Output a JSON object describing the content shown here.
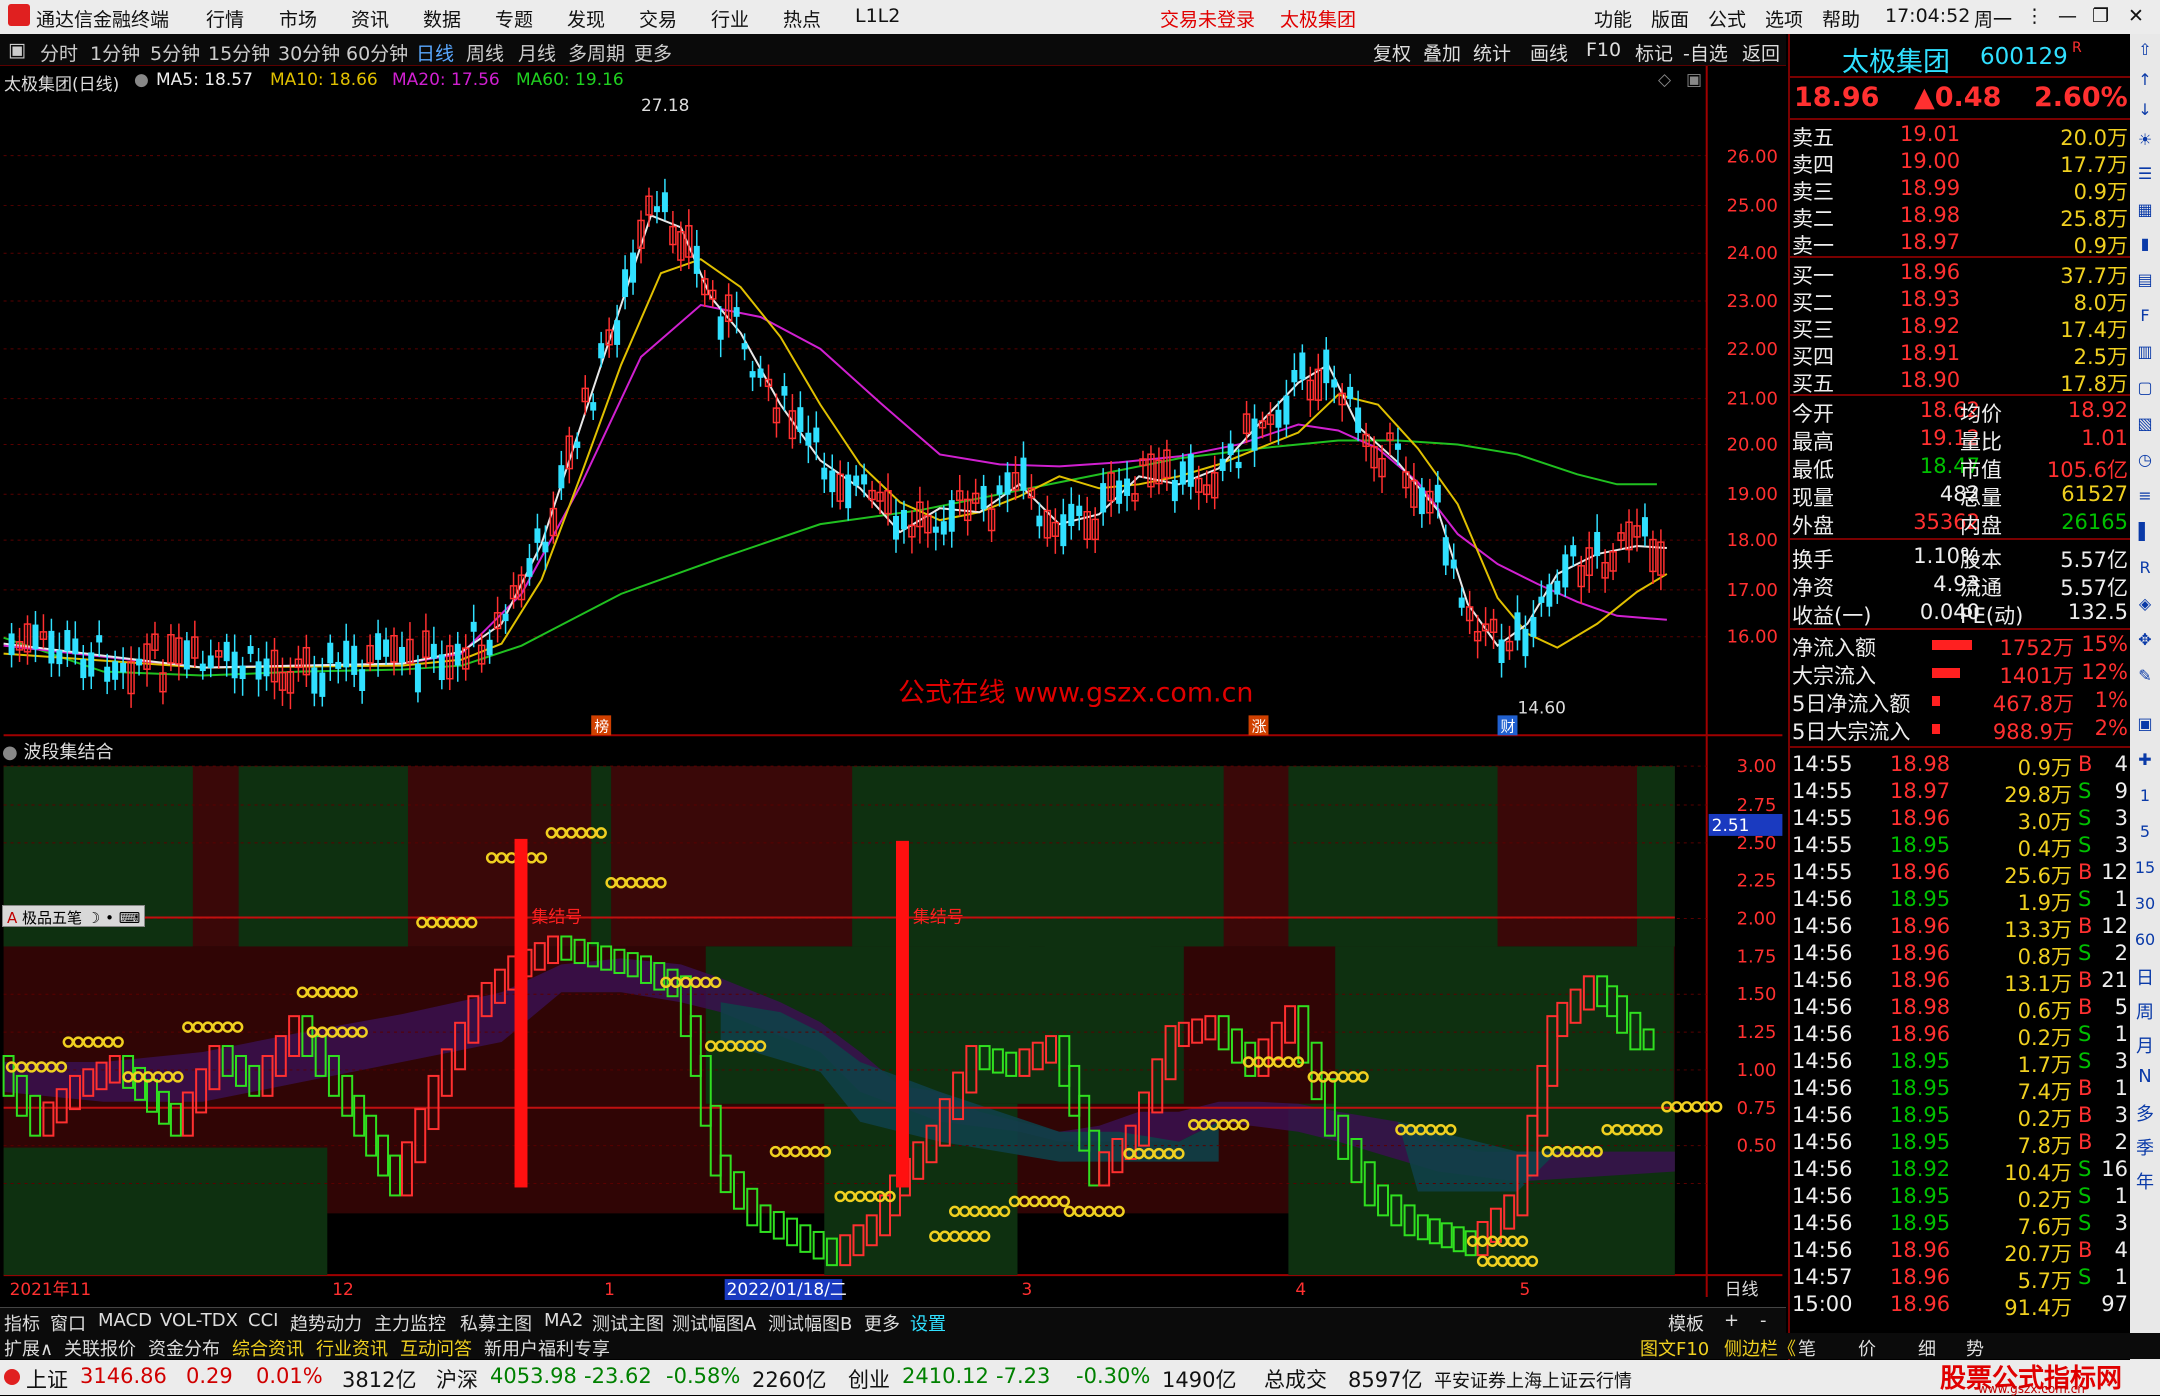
{
  "titlebar": {
    "app": "通达信金融终端",
    "menu": [
      "行情",
      "市场",
      "资讯",
      "数据",
      "专题",
      "发现",
      "交易",
      "行业",
      "热点",
      "L1L2"
    ],
    "login": "交易未登录",
    "stock": "太极集团",
    "right_menu": [
      "功能",
      "版面",
      "公式",
      "选项",
      "帮助"
    ],
    "time": "17:04:52",
    "weekday": "周一"
  },
  "periodbar": {
    "items": [
      "分时",
      "1分钟",
      "5分钟",
      "15分钟",
      "30分钟",
      "60分钟",
      "日线",
      "周线",
      "月线",
      "多周期",
      "更多"
    ],
    "active": "日线",
    "right": [
      "复权",
      "叠加",
      "统计",
      "画线",
      "F10",
      "标记",
      "-自选",
      "返回"
    ]
  },
  "chart_head": {
    "title": "太极集团(日线)",
    "ma5": "MA5: 18.57",
    "ma10": "MA10: 18.66",
    "ma20": "MA20: 17.56",
    "ma60": "MA60: 19.16"
  },
  "main_chart": {
    "high_label": "27.18",
    "low_label": "14.60",
    "watermark": "公式在线 www.gszx.com.cn",
    "price_ticks": [
      "26.00",
      "25.00",
      "24.00",
      "23.00",
      "22.00",
      "21.00",
      "20.00",
      "19.00",
      "18.00",
      "17.00",
      "16.00"
    ],
    "markers": [
      "榜",
      "涨",
      "财"
    ]
  },
  "indicator": {
    "title": "波段集结合",
    "ticks": [
      "3.00",
      "2.75",
      "2.50",
      "2.25",
      "2.00",
      "1.75",
      "1.50",
      "1.25",
      "1.00",
      "0.75",
      "0.50"
    ],
    "current": "2.51",
    "tool_label": "极品五笔",
    "signal1": "集结号",
    "signal2": "集结号"
  },
  "dates": {
    "items": [
      "2021年11",
      "12",
      "1",
      "2022/01/18/二",
      "3",
      "4",
      "5"
    ],
    "period": "日线"
  },
  "quote": {
    "name": "太极集团",
    "code": "600129",
    "flag": "R",
    "price": "18.96",
    "change": "▲0.48",
    "pct": "2.60%",
    "asks": [
      [
        "卖五",
        "19.01",
        "20.0万"
      ],
      [
        "卖四",
        "19.00",
        "17.7万"
      ],
      [
        "卖三",
        "18.99",
        "0.9万"
      ],
      [
        "卖二",
        "18.98",
        "25.8万"
      ],
      [
        "卖一",
        "18.97",
        "0.9万"
      ]
    ],
    "bids": [
      [
        "买一",
        "18.96",
        "37.7万"
      ],
      [
        "买二",
        "18.93",
        "8.0万"
      ],
      [
        "买三",
        "18.92",
        "17.4万"
      ],
      [
        "买四",
        "18.91",
        "2.5万"
      ],
      [
        "买五",
        "18.90",
        "17.8万"
      ]
    ],
    "stats": [
      [
        "今开",
        "18.62",
        "均价",
        "18.92"
      ],
      [
        "最高",
        "19.12",
        "量比",
        "1.01"
      ],
      [
        "最低",
        "18.47",
        "市值",
        "105.6亿"
      ],
      [
        "现量",
        "482",
        "总量",
        "61527"
      ],
      [
        "外盘",
        "35362",
        "内盘",
        "26165"
      ],
      [
        "换手",
        "1.10%",
        "股本",
        "5.57亿"
      ],
      [
        "净资",
        "4.93",
        "流通",
        "5.57亿"
      ],
      [
        "收益(一)",
        "0.040",
        "PE(动)",
        "132.5"
      ]
    ],
    "flows": [
      [
        "净流入额",
        "1752万",
        "15%"
      ],
      [
        "大宗流入",
        "1401万",
        "12%"
      ],
      [
        "5日净流入额",
        "467.8万",
        "1%"
      ],
      [
        "5日大宗流入",
        "988.9万",
        "2%"
      ]
    ],
    "ticks": [
      [
        "14:55",
        "18.98",
        "0.9万",
        "B",
        "4"
      ],
      [
        "14:55",
        "18.97",
        "29.8万",
        "S",
        "9"
      ],
      [
        "14:55",
        "18.96",
        "3.0万",
        "S",
        "3"
      ],
      [
        "14:55",
        "18.95",
        "0.4万",
        "S",
        "3"
      ],
      [
        "14:55",
        "18.96",
        "25.6万",
        "B",
        "12"
      ],
      [
        "14:56",
        "18.95",
        "1.9万",
        "S",
        "1"
      ],
      [
        "14:56",
        "18.96",
        "13.3万",
        "B",
        "12"
      ],
      [
        "14:56",
        "18.96",
        "0.8万",
        "S",
        "2"
      ],
      [
        "14:56",
        "18.96",
        "13.1万",
        "B",
        "21"
      ],
      [
        "14:56",
        "18.98",
        "0.6万",
        "B",
        "5"
      ],
      [
        "14:56",
        "18.96",
        "0.2万",
        "S",
        "1"
      ],
      [
        "14:56",
        "18.95",
        "1.7万",
        "S",
        "3"
      ],
      [
        "14:56",
        "18.95",
        "7.4万",
        "B",
        "1"
      ],
      [
        "14:56",
        "18.95",
        "0.2万",
        "B",
        "3"
      ],
      [
        "14:56",
        "18.95",
        "7.8万",
        "B",
        "2"
      ],
      [
        "14:56",
        "18.92",
        "10.4万",
        "S",
        "16"
      ],
      [
        "14:56",
        "18.95",
        "0.2万",
        "S",
        "1"
      ],
      [
        "14:56",
        "18.95",
        "7.6万",
        "S",
        "3"
      ],
      [
        "14:56",
        "18.96",
        "20.7万",
        "B",
        "4"
      ],
      [
        "14:57",
        "18.96",
        "5.7万",
        "S",
        "1"
      ],
      [
        "15:00",
        "18.96",
        "91.4万",
        "",
        "97"
      ]
    ]
  },
  "strip": [
    "日",
    "周",
    "月",
    "N",
    "多",
    "季",
    "年"
  ],
  "strip_nums": [
    "1",
    "5",
    "15",
    "30",
    "60"
  ],
  "bottomtabs": [
    "指标",
    "窗口",
    "MACD",
    "VOL-TDX",
    "CCI",
    "趋势动力",
    "主力监控",
    "私募主图",
    "MA2",
    "测试主图",
    "测试幅图A",
    "测试幅图B",
    "更多",
    "设置",
    "模板",
    "+",
    "-"
  ],
  "bottomtabs2": [
    "扩展∧",
    "关联报价",
    "资金分布",
    "综合资讯",
    "行业资讯",
    "互动问答",
    "新用户福利专享"
  ],
  "bottomtabs2_right": [
    "图文F10",
    "侧边栏《",
    "笔",
    "价",
    "细",
    "势"
  ],
  "statusbar": {
    "sh_label": "上证",
    "sh": "3146.86",
    "sh_chg": "0.29",
    "sh_pct": "0.01%",
    "sh_amt": "3812亿",
    "hs_label": "沪深",
    "hs": "4053.98",
    "hs_chg": "-23.62",
    "hs_pct": "-0.58%",
    "hs_amt": "2260亿",
    "cy_label": "创业",
    "cy": "2410.12",
    "cy_chg": "-7.23",
    "cy_pct": "-0.30%",
    "cy_amt": "1490亿",
    "total_label": "总成交",
    "total": "8597亿",
    "broker": "平安证券上海上证云行情",
    "logo": "股票公式指标网",
    "logo_url": "www.gszx.com.cn"
  }
}
